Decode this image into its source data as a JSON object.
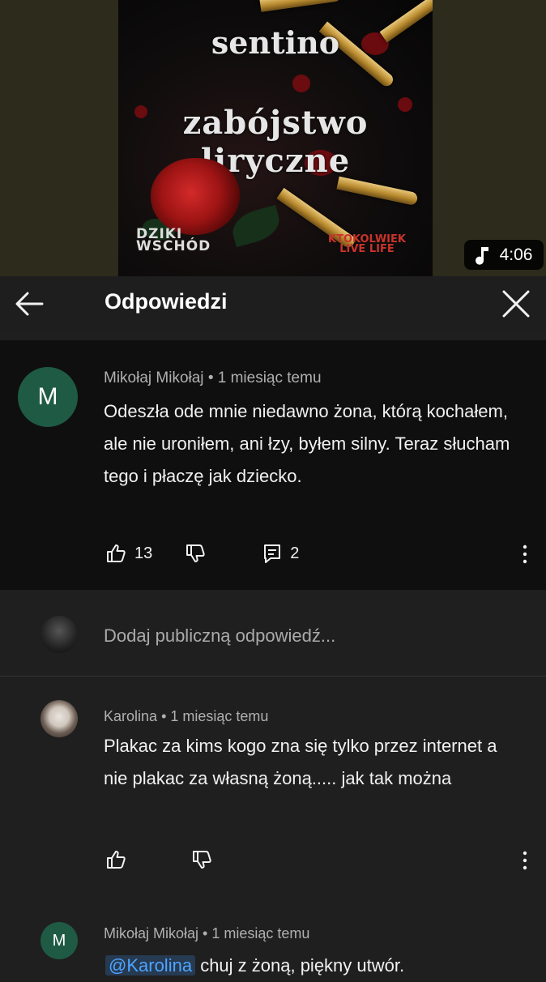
{
  "video": {
    "artist": "sentino",
    "album": "zabójstwo liryczne",
    "label_left": "DZIKI WSCHÓD",
    "label_right": "KTOKOLWIEK LIVE LIFE",
    "duration": "4:06",
    "duration_icon": "music-note-icon"
  },
  "header": {
    "title": "Odpowiedzi",
    "back_icon": "arrow-left-icon",
    "close_icon": "close-icon"
  },
  "comments": [
    {
      "avatar_letter": "M",
      "author": "Mikołaj Mikołaj",
      "time": "1 miesiąc temu",
      "text": "Odeszła ode mnie niedawno żona, którą kochałem, ale nie uroniłem, ani łzy, byłem silny. Teraz słucham tego i płaczę jak dziecko.",
      "likes": "13",
      "replies": "2"
    },
    {
      "author": "Karolina",
      "time": "1 miesiąc temu",
      "text": "Plakac za kims kogo zna się tylko przez internet a nie plakac za własną żoną..... jak tak można"
    },
    {
      "avatar_letter": "M",
      "author": "Mikołaj Mikołaj",
      "time": "1 miesiąc temu",
      "mention": "@Karolina",
      "text": "chuj z żoną, piękny utwór."
    }
  ],
  "reply_input": {
    "placeholder": "Dodaj publiczną odpowiedź..."
  },
  "colors": {
    "background": "#1f1f1f",
    "highlight_comment": "#0f0f0f",
    "avatar_m": "#1f5a45",
    "mention": "#4ea4ff"
  }
}
